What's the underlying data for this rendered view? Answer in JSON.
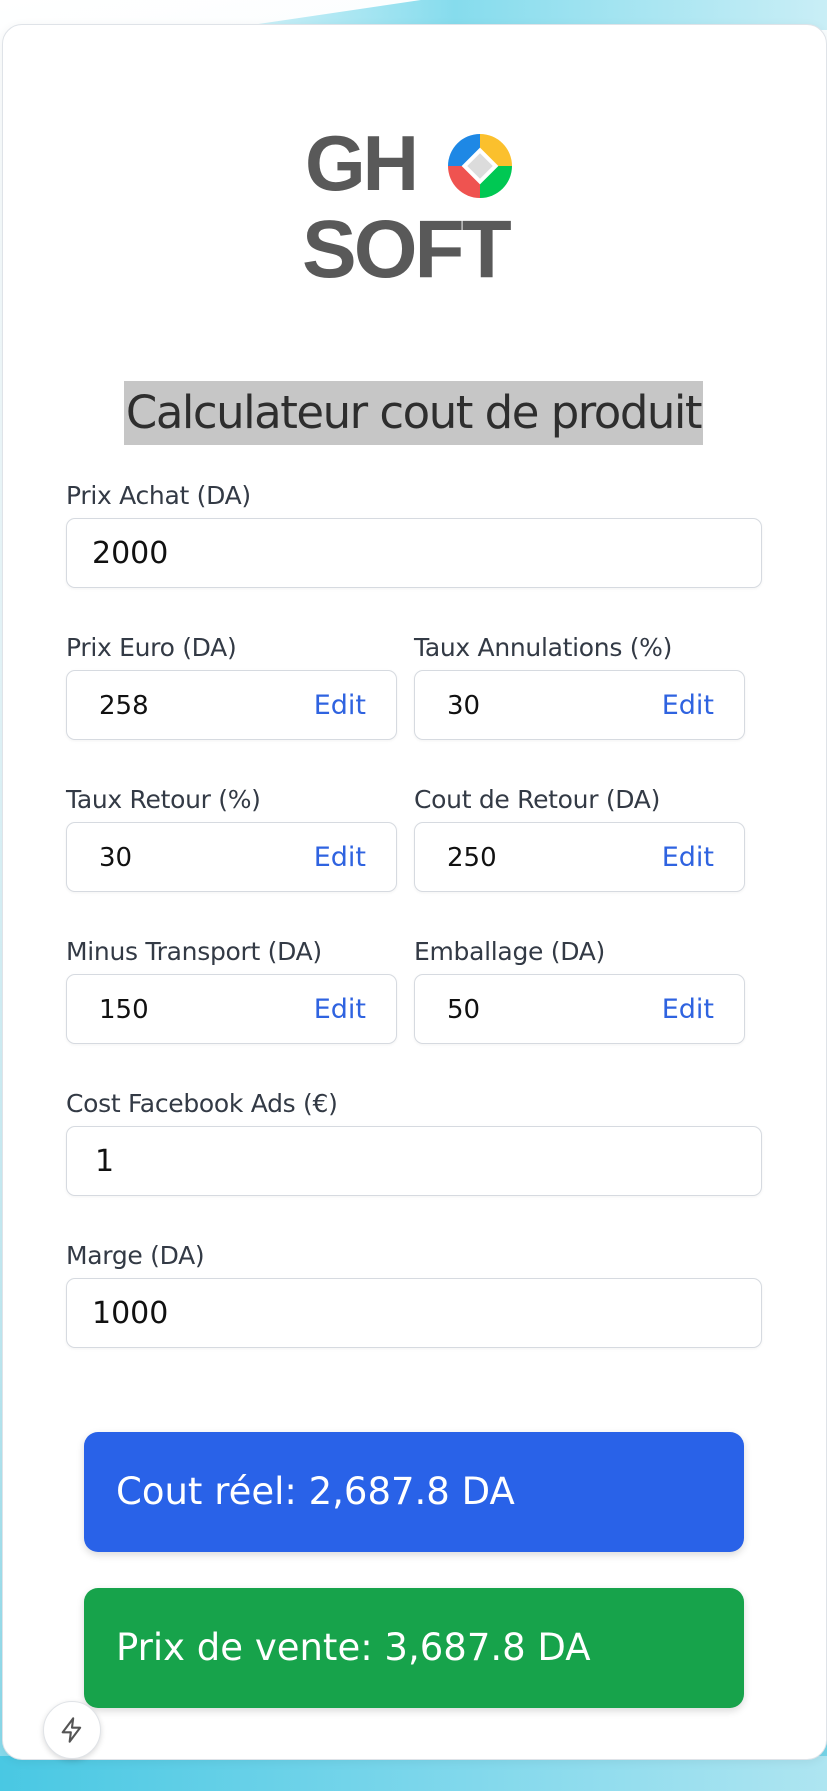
{
  "logo": {
    "line1": "GH",
    "line2": "SOFT",
    "colors": [
      "#1e88e5",
      "#fbc02d",
      "#ef5350",
      "#00c853"
    ]
  },
  "title": "Calculateur cout de produit",
  "fields": {
    "prix_achat": {
      "label": "Prix Achat (DA)",
      "value": "2000"
    },
    "prix_euro": {
      "label": "Prix Euro (DA)",
      "value": "258",
      "edit": "Edit"
    },
    "taux_annulations": {
      "label": "Taux Annulations (%)",
      "value": "30",
      "edit": "Edit"
    },
    "taux_retour": {
      "label": "Taux Retour (%)",
      "value": "30",
      "edit": "Edit"
    },
    "cout_retour": {
      "label": "Cout de Retour (DA)",
      "value": "250",
      "edit": "Edit"
    },
    "minus_transport": {
      "label": "Minus Transport (DA)",
      "value": "150",
      "edit": "Edit"
    },
    "emballage": {
      "label": "Emballage (DA)",
      "value": "50",
      "edit": "Edit"
    },
    "cost_facebook": {
      "label": "Cost Facebook Ads (€)",
      "value": "1"
    },
    "marge": {
      "label": "Marge (DA)",
      "value": "1000"
    }
  },
  "results": {
    "cout_reel": "Cout réel: 2,687.8 DA",
    "prix_vente": "Prix de vente: 3,687.8 DA"
  },
  "colors": {
    "accent_blue": "#2962e8",
    "accent_green": "#17a34b",
    "edit_link": "#2f63e0"
  },
  "fab_icon": "lightning-icon"
}
